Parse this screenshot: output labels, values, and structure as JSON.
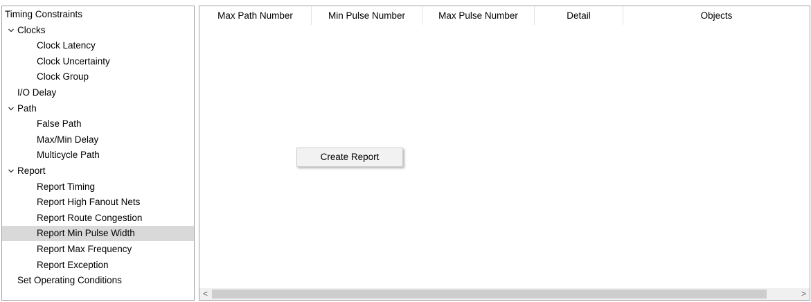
{
  "tree": {
    "items": [
      {
        "label": "Timing Constraints",
        "level": 0,
        "expander": false
      },
      {
        "label": "Clocks",
        "level": 0,
        "expander": true
      },
      {
        "label": "Clock Latency",
        "level": 2,
        "expander": false
      },
      {
        "label": "Clock Uncertainty",
        "level": 2,
        "expander": false
      },
      {
        "label": "Clock Group",
        "level": 2,
        "expander": false
      },
      {
        "label": "I/O Delay",
        "level": 1,
        "expander": false
      },
      {
        "label": "Path",
        "level": 0,
        "expander": true
      },
      {
        "label": "False Path",
        "level": 2,
        "expander": false
      },
      {
        "label": "Max/Min Delay",
        "level": 2,
        "expander": false
      },
      {
        "label": "Multicycle Path",
        "level": 2,
        "expander": false
      },
      {
        "label": "Report",
        "level": 0,
        "expander": true
      },
      {
        "label": "Report Timing",
        "level": 2,
        "expander": false
      },
      {
        "label": "Report High Fanout Nets",
        "level": 2,
        "expander": false
      },
      {
        "label": "Report Route Congestion",
        "level": 2,
        "expander": false
      },
      {
        "label": "Report Min Pulse Width",
        "level": 2,
        "expander": false,
        "selected": true
      },
      {
        "label": "Report Max Frequency",
        "level": 2,
        "expander": false
      },
      {
        "label": "Report Exception",
        "level": 2,
        "expander": false
      },
      {
        "label": "Set Operating Conditions",
        "level": 1,
        "expander": false
      }
    ],
    "expander_icon": "chevron-down-icon",
    "selected_color": "#d9d9d9"
  },
  "table": {
    "columns": [
      "Max Path Number",
      "Min Pulse Number",
      "Max Pulse Number",
      "Detail",
      "Objects"
    ]
  },
  "context_menu": {
    "items": [
      "Create Report"
    ]
  },
  "scrollbar": {
    "left_icon": "chevron-left-icon",
    "right_icon": "chevron-right-icon",
    "left_glyph": "<",
    "right_glyph": ">"
  }
}
